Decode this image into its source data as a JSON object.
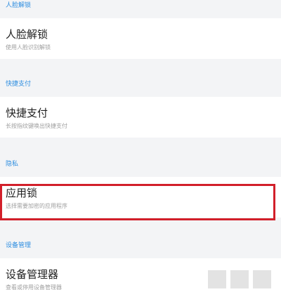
{
  "sections": [
    {
      "header": "人脸解锁",
      "row": {
        "title": "人脸解锁",
        "subtitle": "使用人脸识别解锁"
      }
    },
    {
      "header": "快捷支付",
      "row": {
        "title": "快捷支付",
        "subtitle": "长按指纹键唤出快捷支付"
      }
    },
    {
      "header": "隐私",
      "row": {
        "title": "应用锁",
        "subtitle": "选择需要加密的应用程序"
      }
    },
    {
      "header": "设备管理",
      "row": {
        "title": "设备管理器",
        "subtitle": "查看或停用设备管理器"
      }
    }
  ],
  "colors": {
    "section_header": "#2f8ee0",
    "highlight_border": "#d21f2a",
    "background": "#f3f4f6"
  }
}
